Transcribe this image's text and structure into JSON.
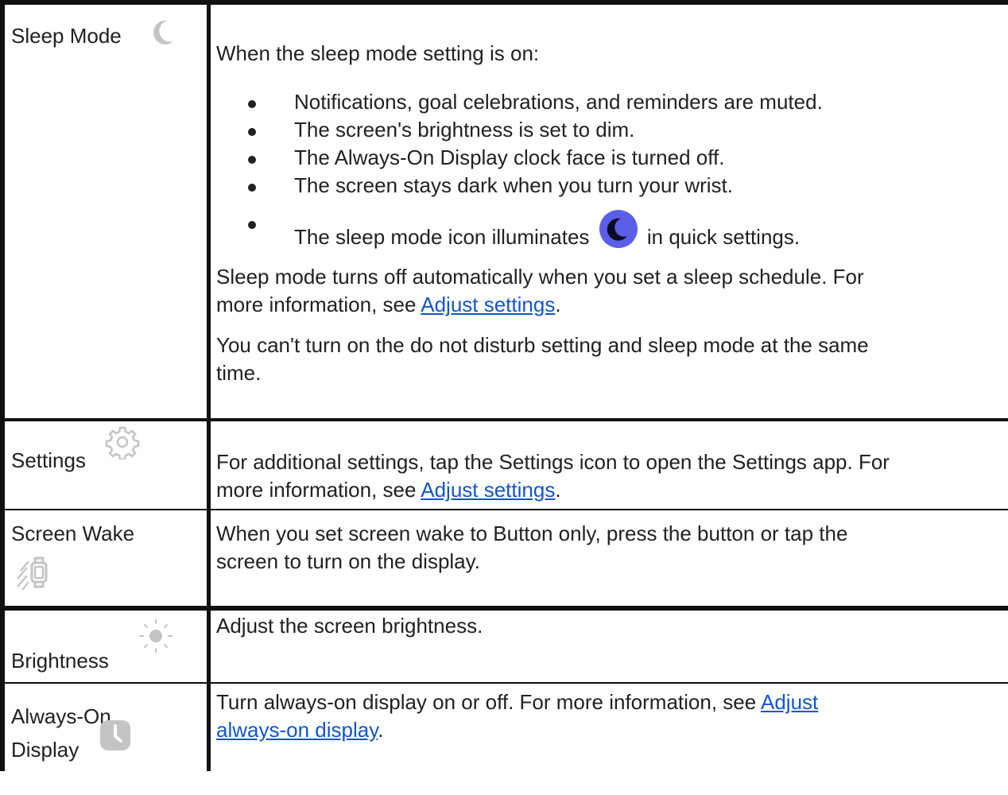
{
  "rows": [
    {
      "label": "Sleep Mode",
      "icon": "moon-icon",
      "intro": "When the sleep mode setting is on:",
      "bullets": [
        "Notifications, goal celebrations, and reminders are muted.",
        "The screen's brightness is set to dim.",
        "The Always-On Display clock face is turned off.",
        "The screen stays dark when you turn your wrist."
      ],
      "bullet_icon_before": "The sleep mode icon illuminates",
      "bullet_icon_after": "in quick settings.",
      "bullet_icon": "sleep-mode-quick-settings-icon",
      "para1_line1": "Sleep mode turns off automatically when you set a sleep schedule. For",
      "para1_line2_prefix": "more information, see ",
      "para1_link": "Adjust settings",
      "para1_suffix": ".",
      "para2_line1": "You can't turn on the do not disturb setting and sleep mode at the same",
      "para2_line2": "time."
    },
    {
      "label": "Settings",
      "icon": "gear-icon",
      "line1": "For additional settings, tap the Settings icon to open the Settings app. For",
      "line2_prefix": "more information, see ",
      "link": "Adjust settings",
      "suffix": "."
    },
    {
      "label": "Screen Wake",
      "icon": "watch-wake-icon",
      "line1": "When you set screen wake to Button only, press the button or tap the",
      "line2": "screen to turn on the display."
    },
    {
      "label": "Brightness",
      "icon": "sun-icon",
      "line1": "Adjust the screen brightness."
    },
    {
      "label_line1": "Always-On",
      "label_line2": "Display",
      "icon": "clock-icon",
      "line1_prefix": "Turn always-on display on or off. For more information, see ",
      "link_part1": "Adjust",
      "link_part2": "always-on display",
      "suffix": "."
    }
  ],
  "colors": {
    "text": "#202124",
    "link": "#1155cc",
    "border": "#111111",
    "icon_gray": "#c4c4c4",
    "sleep_icon_bg": "#5b5fe8"
  }
}
